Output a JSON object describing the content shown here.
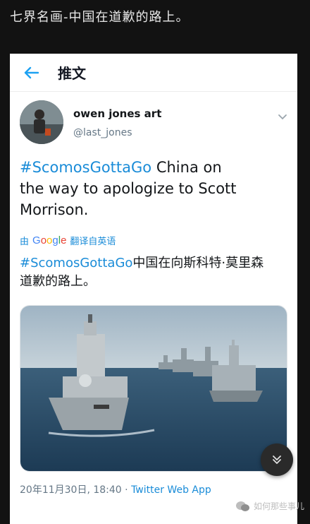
{
  "page_caption": "七界名画-中国在道歉的路上。",
  "top_bar": {
    "title": "推文"
  },
  "author": {
    "display_name": "owen jones art",
    "handle": "@last_jones"
  },
  "tweet": {
    "hashtag": "#ScomosGottaGo",
    "text_line1_rest": " China on",
    "text_line2": "the way to apologize to Scott",
    "text_line3": "Morrison."
  },
  "translation": {
    "prefix": "由",
    "provider": "Google",
    "suffix": "翻译自英语",
    "hashtag": "#ScomosGottaGo",
    "text_line1_rest": "中国在向斯科特·莫里森",
    "text_line2": "道歉的路上。"
  },
  "meta": {
    "timestamp": "20年11月30日, 18:40",
    "separator": " · ",
    "source": "Twitter Web App"
  },
  "watermark": {
    "text": "如何那些事儿"
  },
  "colors": {
    "link": "#1a8cd8",
    "text": "#14171a",
    "secondary": "#657786",
    "background": "#121212"
  },
  "icons": [
    "back-arrow-icon",
    "chevron-down-icon",
    "double-chevron-down-icon",
    "wechat-icon"
  ]
}
